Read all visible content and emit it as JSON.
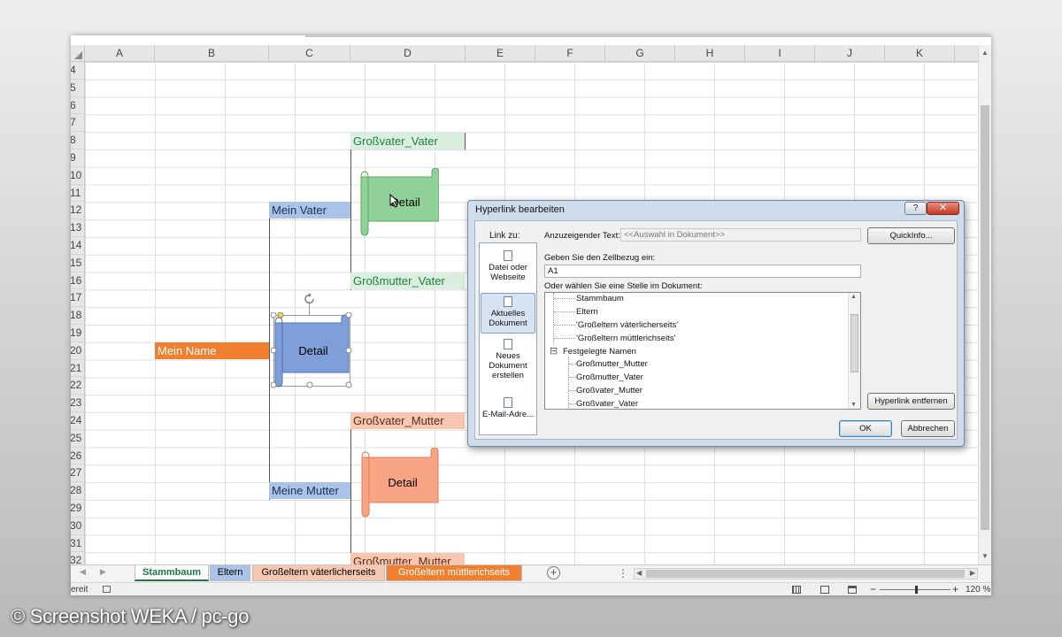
{
  "columns": [
    "A",
    "B",
    "C",
    "D",
    "E",
    "F",
    "G",
    "H",
    "I",
    "J",
    "K"
  ],
  "rows": [
    "4",
    "5",
    "6",
    "7",
    "8",
    "9",
    "10",
    "11",
    "12",
    "13",
    "14",
    "15",
    "16",
    "17",
    "18",
    "19",
    "20",
    "21",
    "22",
    "23",
    "24",
    "25",
    "26",
    "27",
    "28",
    "29",
    "30",
    "31",
    "32"
  ],
  "cells": {
    "grossvater_vater": "Großvater_Vater",
    "mein_vater": "Mein Vater",
    "grossmutter_vater": "Großmutter_Vater",
    "mein_name": "Mein Name",
    "grossvater_mutter": "Großvater_Mutter",
    "meine_mutter": "Meine Mutter",
    "grossmutter_mutter": "Großmutter_Mutter"
  },
  "shapes": {
    "green_label": "Detail",
    "blue_label": "Detail",
    "orange_label": "Detail"
  },
  "colors": {
    "green_cell": "#dbefe0",
    "green_text": "#1e7d3c",
    "blue_cell": "#a9c4e8",
    "orange_cell": "#f08030",
    "salmon_cell": "#f8c7b2",
    "green_shape": "#8fd196",
    "blue_shape": "#7e9fd8",
    "orange_shape": "#f8a585"
  },
  "tabs": [
    {
      "label": "Stammbaum",
      "active": true
    },
    {
      "label": "Eltern"
    },
    {
      "label": "Großeltern väterlicherseits"
    },
    {
      "label": "Großeltern müttlerichseits"
    }
  ],
  "status": {
    "ready": "ereit",
    "zoom": "120 %"
  },
  "dialog": {
    "title": "Hyperlink bearbeiten",
    "help": "?",
    "close": "✕",
    "link_zu": "Link zu:",
    "options": [
      {
        "label": "Datei oder Webseite"
      },
      {
        "label": "Aktuelles Dokument",
        "active": true
      },
      {
        "label": "Neues Dokument erstellen"
      },
      {
        "label": "E-Mail-Adre..."
      }
    ],
    "display_text_label": "Anzuzeigender Text:",
    "display_text_value": "<<Auswahl in Dokument>>",
    "quickinfo_button": "QuickInfo...",
    "cell_ref_label": "Geben Sie den Zellbezug ein:",
    "cell_ref_value": "A1",
    "location_label": "Oder wählen Sie eine Stelle im Dokument:",
    "tree_items": [
      "Stammbaum",
      "Eltern",
      "'Großeltern väterlicherseits'",
      "'Großeltern müttlerichseits'",
      "Festgelegte Namen",
      "Großmutter_Mutter",
      "Großmutter_Vater",
      "Großvater_Mutter",
      "Großvater_Vater"
    ],
    "tree_toggle": "⊟",
    "remove_button": "Hyperlink entfernen",
    "ok_button": "OK",
    "cancel_button": "Abbrechen"
  },
  "watermark": "© Screenshot WEKA / pc-go"
}
